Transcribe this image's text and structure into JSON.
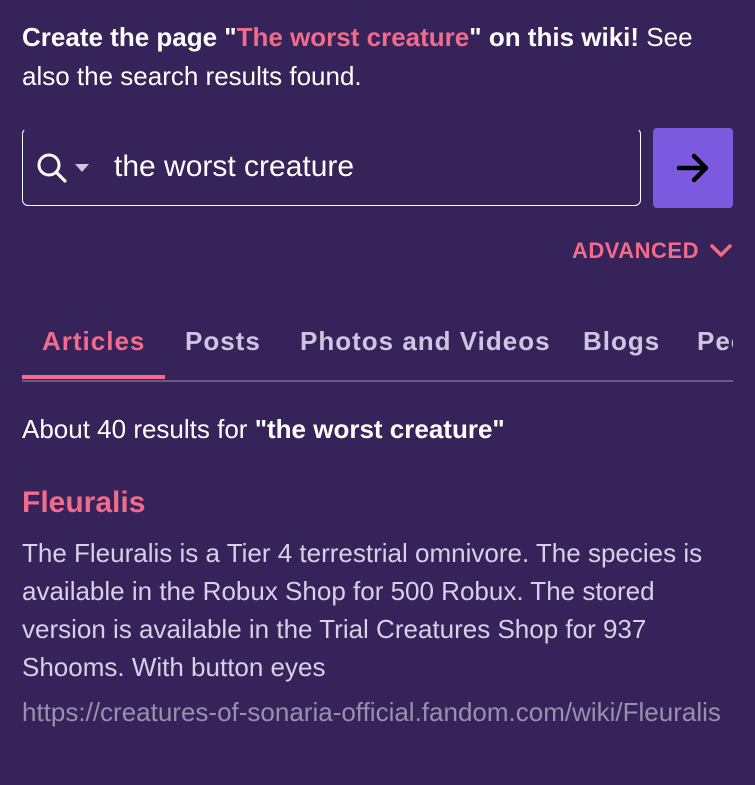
{
  "create_notice": {
    "prefix": "Create the page \"",
    "page_name": "The worst creature",
    "suffix": "\" on this wiki!",
    "tail": " See also the search results found."
  },
  "search": {
    "value": "the worst creature",
    "placeholder": "Search"
  },
  "advanced": {
    "label": "ADVANCED"
  },
  "tabs": [
    {
      "label": "Articles",
      "active": true
    },
    {
      "label": "Posts",
      "active": false
    },
    {
      "label": "Photos and Videos",
      "active": false
    },
    {
      "label": "Blogs",
      "active": false
    },
    {
      "label": "People",
      "active": false
    }
  ],
  "results": {
    "count_prefix": "About 40 results for ",
    "query_display": "\"the worst creature\"",
    "items": [
      {
        "title": "Fleuralis",
        "snippet": "The Fleuralis is a Tier 4 terrestrial omnivore. The species is available in the Robux Shop for 500 Robux. The stored version is available in the Trial Creatures Shop for 937 Shooms. With button eyes",
        "url": "https://creatures-of-sonaria-official.fandom.com/wiki/Fleuralis"
      }
    ]
  },
  "colors": {
    "background": "#35235a",
    "accent": "#f26b8a",
    "button": "#7b5ae0"
  }
}
